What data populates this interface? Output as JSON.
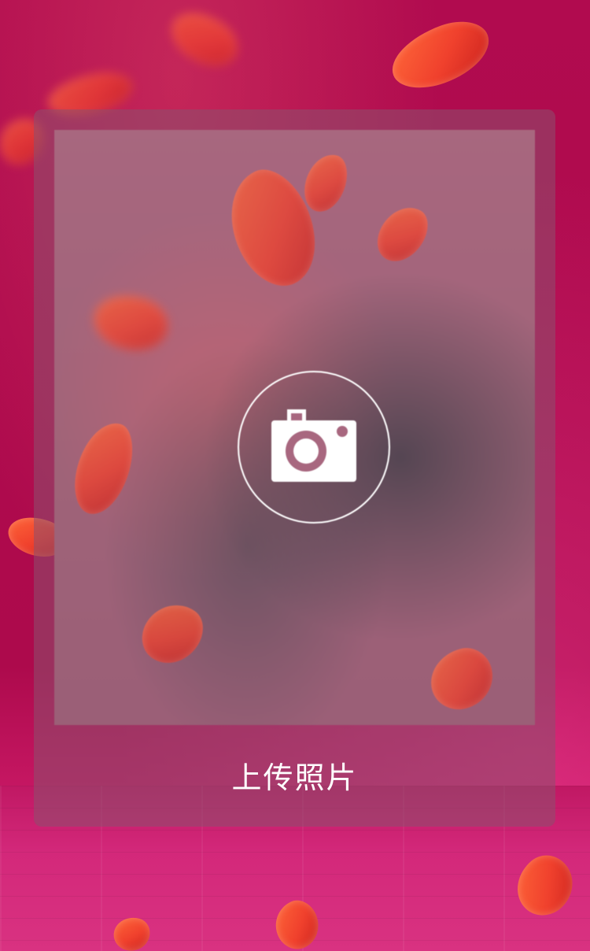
{
  "upload": {
    "label": "上传照片",
    "icon": "camera-icon"
  },
  "colors": {
    "background": "#ad0a4c",
    "petal": "#f0412d",
    "overlay": "#8c506e",
    "text": "#ffffff"
  }
}
